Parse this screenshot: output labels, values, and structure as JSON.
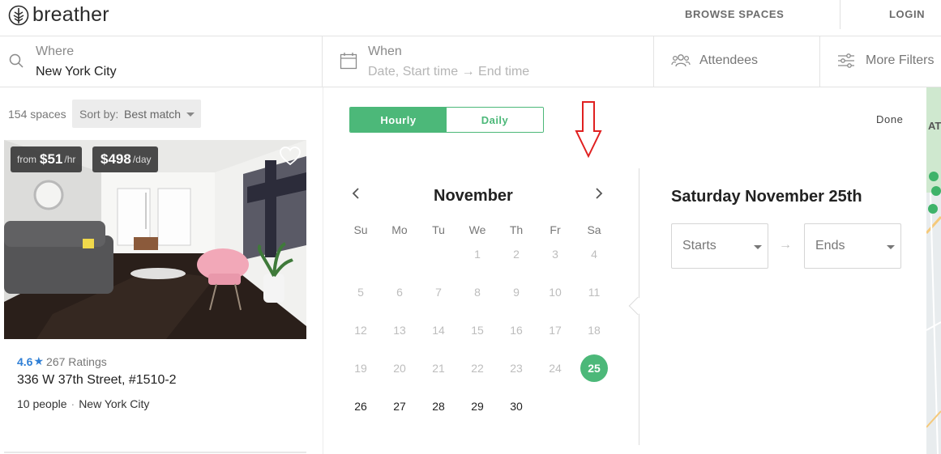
{
  "header": {
    "brand": "breather",
    "nav": {
      "browse": "BROWSE SPACES",
      "login": "LOGIN"
    }
  },
  "search": {
    "where_label": "Where",
    "where_value": "New York City",
    "when_label": "When",
    "when_placeholder": "Date, Start time → End time",
    "attendees_label": "Attendees",
    "more_filters_label": "More Filters"
  },
  "results": {
    "count": "154 spaces",
    "sort_label": "Sort by:",
    "sort_value": "Best match"
  },
  "listing": {
    "price_hour_from": "from",
    "price_hour_value": "$51",
    "price_hour_unit": "/hr",
    "price_day_value": "$498",
    "price_day_unit": "/day",
    "rating": "4.6",
    "rating_count": "267 Ratings",
    "address": "336 W 37th Street, #1510-2",
    "capacity": "10 people",
    "city": "New York City"
  },
  "datepicker": {
    "toggle_hourly": "Hourly",
    "toggle_daily": "Daily",
    "done": "Done",
    "month": "November",
    "weekdays": [
      "Su",
      "Mo",
      "Tu",
      "We",
      "Th",
      "Fr",
      "Sa"
    ],
    "weeks": [
      [
        "",
        "",
        "",
        "1",
        "2",
        "3",
        "4"
      ],
      [
        "5",
        "6",
        "7",
        "8",
        "9",
        "10",
        "11"
      ],
      [
        "12",
        "13",
        "14",
        "15",
        "16",
        "17",
        "18"
      ],
      [
        "19",
        "20",
        "21",
        "22",
        "23",
        "24",
        "25"
      ],
      [
        "26",
        "27",
        "28",
        "29",
        "30",
        "",
        ""
      ]
    ],
    "selected_day": "25",
    "first_available_day": "25",
    "selected_date_title": "Saturday November 25th",
    "starts_label": "Starts",
    "ends_label": "Ends"
  },
  "map": {
    "edge_label": "AT"
  },
  "colors": {
    "accent_green": "#4cb879",
    "rating_blue": "#2f7fd6",
    "annotation_red": "#e02020"
  }
}
